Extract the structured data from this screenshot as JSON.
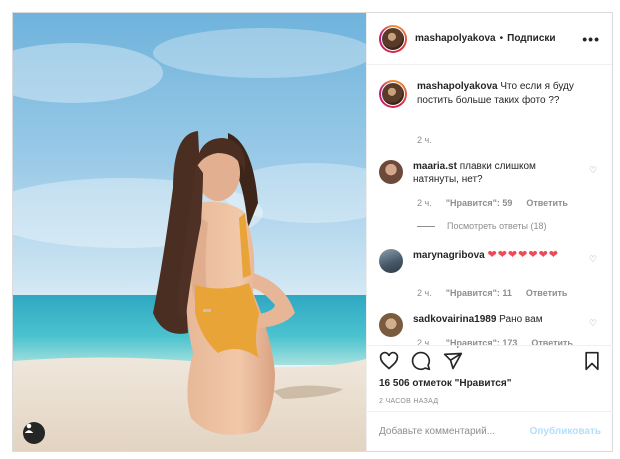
{
  "header": {
    "username": "mashapolyakova",
    "separator": "•",
    "follow_label": "Подписки",
    "more_icon": "more-horizontal-icon"
  },
  "caption": {
    "username": "mashapolyakova",
    "text": "Что если я буду постить больше таких фото ??",
    "time": "2 ч."
  },
  "comments": [
    {
      "username": "maaria.st",
      "text": "плавки слишком натянуты, нет?",
      "time": "2 ч.",
      "likes": "\"Нравится\": 59",
      "reply": "Ответить",
      "view_replies": "Посмотреть ответы (18)"
    },
    {
      "username": "marynagribova",
      "text": "❤❤❤❤❤❤❤",
      "time": "2 ч.",
      "likes": "\"Нравится\": 11",
      "reply": "Ответить"
    },
    {
      "username": "sadkovairina1989",
      "text": "Рано вам",
      "time": "2 ч.",
      "likes": "\"Нравится\": 173",
      "reply": "Ответить"
    }
  ],
  "actions": {
    "like_icon": "heart-icon",
    "comment_icon": "comment-icon",
    "share_icon": "share-icon",
    "save_icon": "bookmark-icon",
    "likes_text": "16 506 отметок \"Нравится\"",
    "posted_ago": "2 ЧАСОВ НАЗАД"
  },
  "add_comment": {
    "placeholder": "Добавьте комментарий...",
    "publish_label": "Опубликовать"
  },
  "colors": {
    "accent": "#0095f6",
    "publish_disabled": "#b2dffc",
    "heart_red": "#ed4956",
    "muted": "#8e8e8e"
  }
}
